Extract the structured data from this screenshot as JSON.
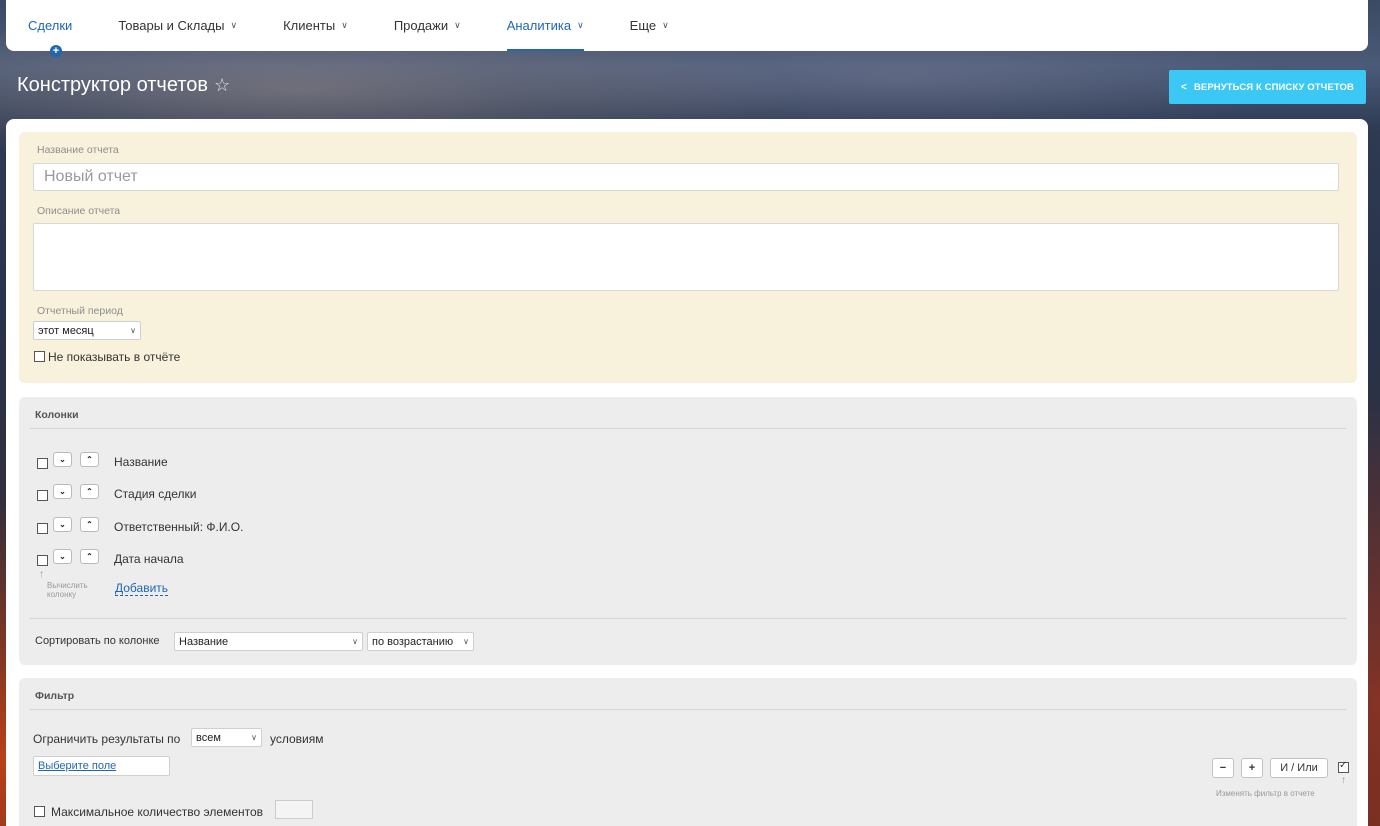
{
  "nav": {
    "items": [
      {
        "label": "Сделки",
        "chevron": false
      },
      {
        "label": "Товары и Склады",
        "chevron": true
      },
      {
        "label": "Клиенты",
        "chevron": true
      },
      {
        "label": "Продажи",
        "chevron": true
      },
      {
        "label": "Аналитика",
        "chevron": true
      },
      {
        "label": "Еще",
        "chevron": true
      }
    ],
    "active_color": "#2067b0"
  },
  "header": {
    "title": "Конструктор отчетов",
    "back_button": "ВЕРНУТЬСЯ К СПИСКУ ОТЧЕТОВ",
    "back_button_color": "#3bc8f5"
  },
  "info": {
    "name_label": "Название отчета",
    "name_placeholder": "Новый отчет",
    "desc_label": "Описание отчета",
    "period_label": "Отчетный период",
    "period_value": "этот месяц",
    "hide_label": "Не показывать в отчёте"
  },
  "columns": {
    "title": "Колонки",
    "rows": [
      "Название",
      "Стадия сделки",
      "Ответственный: Ф.И.О.",
      "Дата начала"
    ],
    "calc_hint_1": "Вычислить",
    "calc_hint_2": "колонку",
    "add_link": "Добавить",
    "sort_label": "Сортировать по колонке",
    "sort_column": "Название",
    "sort_order": "по возрастанию"
  },
  "filter": {
    "title": "Фильтр",
    "limit_prefix": "Ограничить результаты по",
    "limit_value": "всем",
    "limit_suffix": "условиям",
    "field_link": "Выберите поле",
    "minus": "−",
    "plus": "+",
    "and_or": "И / Или",
    "change_hint": "Изменять фильтр в отчете",
    "max_label": "Максимальное количество элементов"
  }
}
